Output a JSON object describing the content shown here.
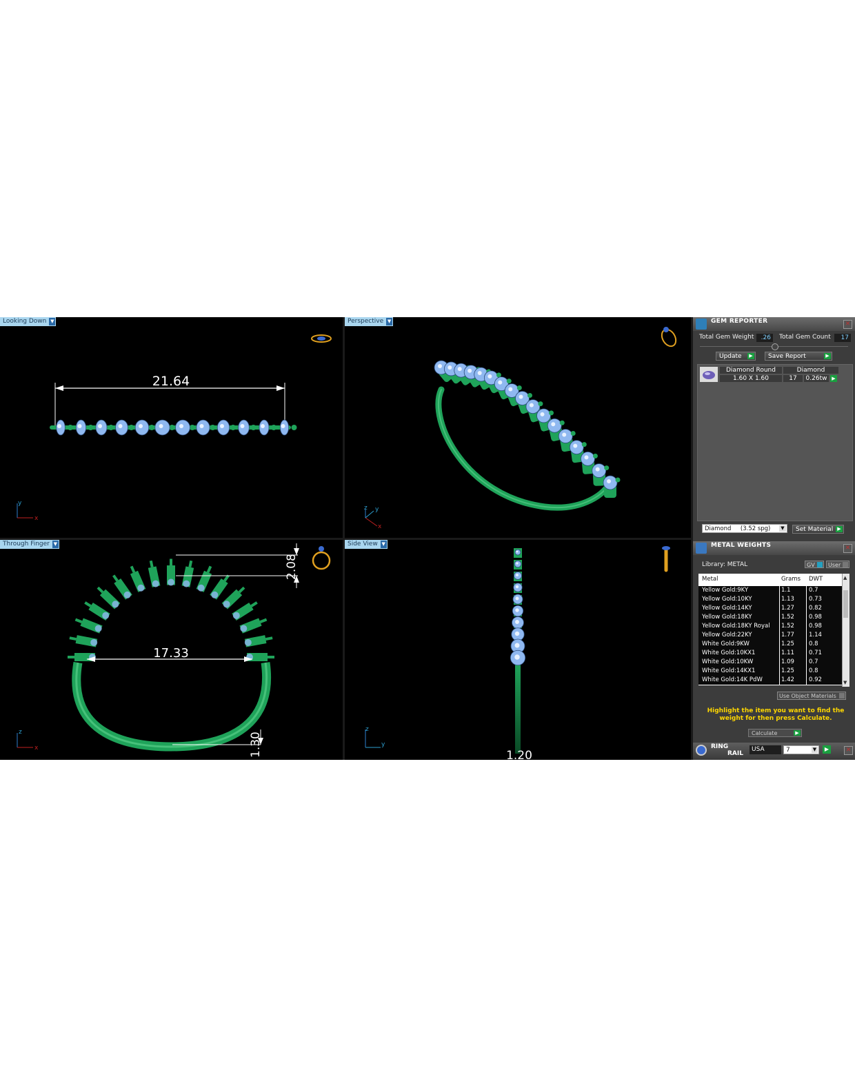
{
  "viewports": {
    "top_left": {
      "tab": "Looking Down",
      "dimension": "21.64",
      "axes": [
        "y",
        "x"
      ]
    },
    "top_right": {
      "tab": "Perspective",
      "axes": [
        "z",
        "y",
        "x"
      ]
    },
    "bottom_left": {
      "tab": "Through Finger",
      "dimensions": [
        "17.33",
        "2.08",
        "1.30"
      ],
      "axes": [
        "z",
        "x"
      ]
    },
    "bottom_right": {
      "tab": "Side View",
      "dimension": "1.20",
      "axes": [
        "z",
        "y"
      ]
    }
  },
  "gem_reporter": {
    "title": "GEM REPORTER",
    "total_gem_weight_label": "Total Gem Weight",
    "total_gem_weight": ".26",
    "total_gem_count_label": "Total Gem Count",
    "total_gem_count": "17",
    "update_label": "Update",
    "save_report_label": "Save Report",
    "gem": {
      "name": "Diamond Round",
      "size": "1.60 X 1.60",
      "material": "Diamond",
      "count": "17",
      "weight": "0.26tw"
    },
    "material_select": "Diamond     (3.52 spg)",
    "set_material_label": "Set Material"
  },
  "metal_weights": {
    "title": "METAL WEIGHTS",
    "library": "Library: METAL",
    "gv_label": "GV",
    "user_label": "User",
    "columns": [
      "Metal",
      "Grams",
      "DWT"
    ],
    "rows": [
      [
        "Yellow Gold:9KY",
        "1.1",
        "0.7"
      ],
      [
        "Yellow Gold:10KY",
        "1.13",
        "0.73"
      ],
      [
        "Yellow Gold:14KY",
        "1.27",
        "0.82"
      ],
      [
        "Yellow Gold:18KY",
        "1.52",
        "0.98"
      ],
      [
        "Yellow Gold:18KY Royal",
        "1.52",
        "0.98"
      ],
      [
        "Yellow Gold:22KY",
        "1.77",
        "1.14"
      ],
      [
        "White Gold:9KW",
        "1.25",
        "0.8"
      ],
      [
        "White Gold:10KX1",
        "1.11",
        "0.71"
      ],
      [
        "White Gold:10KW",
        "1.09",
        "0.7"
      ],
      [
        "White Gold:14KX1",
        "1.25",
        "0.8"
      ],
      [
        "White Gold:14K PdW",
        "1.42",
        "0.92"
      ]
    ],
    "use_object_materials_label": "Use Object Materials",
    "hint": "Highlight the item you want to find the weight for then press Calculate.",
    "calculate_label": "Calculate"
  },
  "ring_rail": {
    "title_1": "RING",
    "title_2": "RAIL",
    "region": "USA",
    "size": "7"
  },
  "colors": {
    "metal_green": "#1fa35a",
    "gem_blue": "#8fb8f0",
    "viewport_bg": "#000000",
    "tab_bg": "#a9d6ef"
  }
}
